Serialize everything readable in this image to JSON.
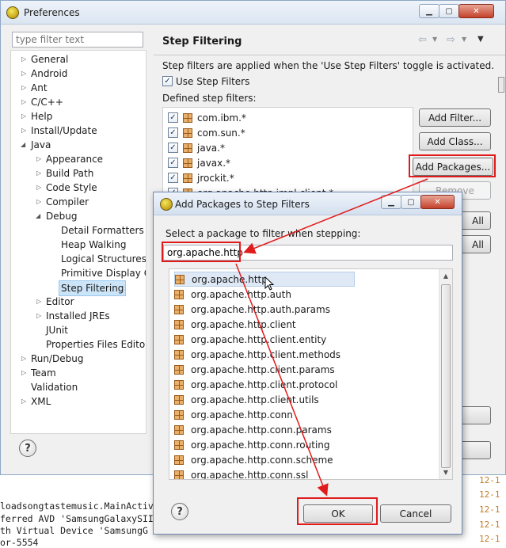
{
  "preferences": {
    "title": "Preferences",
    "filter_placeholder": "type filter text",
    "tree": [
      {
        "label": "General"
      },
      {
        "label": "Android"
      },
      {
        "label": "Ant"
      },
      {
        "label": "C/C++"
      },
      {
        "label": "Help"
      },
      {
        "label": "Install/Update"
      },
      {
        "label": "Java"
      },
      {
        "label": "Appearance"
      },
      {
        "label": "Build Path"
      },
      {
        "label": "Code Style"
      },
      {
        "label": "Compiler"
      },
      {
        "label": "Debug"
      },
      {
        "label": "Detail Formatters"
      },
      {
        "label": "Heap Walking"
      },
      {
        "label": "Logical Structures"
      },
      {
        "label": "Primitive Display Op"
      },
      {
        "label": "Step Filtering"
      },
      {
        "label": "Editor"
      },
      {
        "label": "Installed JREs"
      },
      {
        "label": "JUnit"
      },
      {
        "label": "Properties Files Editor"
      },
      {
        "label": "Run/Debug"
      },
      {
        "label": "Team"
      },
      {
        "label": "Validation"
      },
      {
        "label": "XML"
      }
    ],
    "page": {
      "title": "Step Filtering",
      "description": "Step filters are applied when the 'Use Step Filters' toggle is activated.",
      "use_step_filters_label": "Use Step Filters",
      "defined_label": "Defined step filters:",
      "filters": [
        {
          "name": "com.ibm.*"
        },
        {
          "name": "com.sun.*"
        },
        {
          "name": "java.*"
        },
        {
          "name": "javax.*"
        },
        {
          "name": "jrockit.*"
        },
        {
          "name": "org.apache.http.impl.client.*"
        }
      ],
      "buttons": {
        "add_filter": "Add Filter...",
        "add_class": "Add Class...",
        "add_packages": "Add Packages...",
        "remove": "Remove",
        "select_all_fragment": "All",
        "deselect_all_fragment": "All"
      }
    }
  },
  "console": {
    "lines": [
      "loadsongtastemusic.MainActiv",
      "ferred AVD 'SamsungGalaxySII",
      "th Virtual Device 'SamsungG",
      "or-5554"
    ],
    "times": [
      "12-1",
      "12-1",
      "12-1",
      "12-1",
      "12-1"
    ]
  },
  "dialog": {
    "title": "Add Packages to Step Filters",
    "prompt": "Select a package to filter when stepping:",
    "input_value": "org.apache.http",
    "packages": [
      "org.apache.http",
      "org.apache.http.auth",
      "org.apache.http.auth.params",
      "org.apache.http.client",
      "org.apache.http.client.entity",
      "org.apache.http.client.methods",
      "org.apache.http.client.params",
      "org.apache.http.client.protocol",
      "org.apache.http.client.utils",
      "org.apache.http.conn",
      "org.apache.http.conn.params",
      "org.apache.http.conn.routing",
      "org.apache.http.conn.scheme",
      "org.apache.http.conn.ssl"
    ],
    "ok_label": "OK",
    "cancel_label": "Cancel"
  },
  "colors": {
    "annotation": "#e11b1b",
    "selection": "#cce4f7"
  }
}
